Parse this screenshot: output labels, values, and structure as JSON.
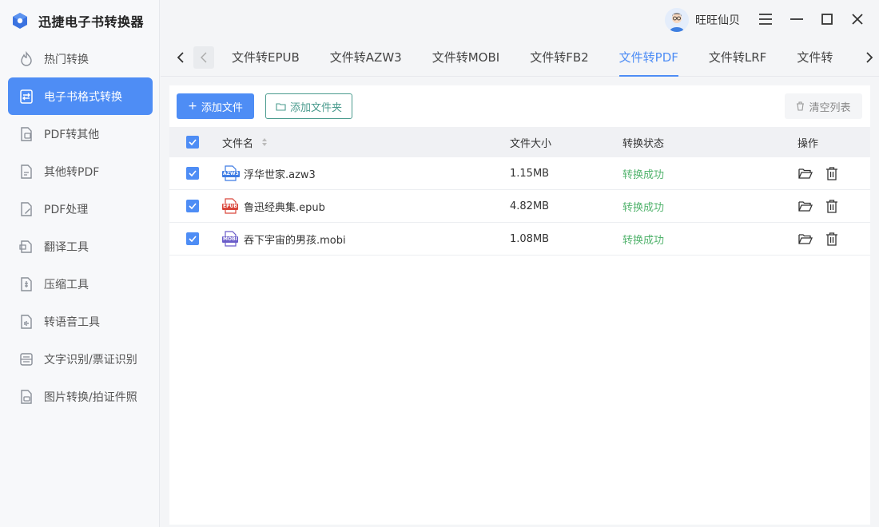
{
  "app": {
    "title": "迅捷电子书转换器"
  },
  "sidebar": {
    "items": [
      {
        "label": "热门转换",
        "icon": "flame-icon"
      },
      {
        "label": "电子书格式转换",
        "icon": "ebook-convert-icon"
      },
      {
        "label": "PDF转其他",
        "icon": "pdf-export-icon"
      },
      {
        "label": "其他转PDF",
        "icon": "pdf-import-icon"
      },
      {
        "label": "PDF处理",
        "icon": "pdf-edit-icon"
      },
      {
        "label": "翻译工具",
        "icon": "translate-icon"
      },
      {
        "label": "压缩工具",
        "icon": "compress-icon"
      },
      {
        "label": "转语音工具",
        "icon": "audio-icon"
      },
      {
        "label": "文字识别/票证识别",
        "icon": "ocr-icon"
      },
      {
        "label": "图片转换/拍证件照",
        "icon": "image-icon"
      }
    ]
  },
  "user": {
    "name": "旺旺仙贝"
  },
  "tabs": {
    "items": [
      "文件转EPUB",
      "文件转AZW3",
      "文件转MOBI",
      "文件转FB2",
      "文件转PDF",
      "文件转LRF",
      "文件转"
    ],
    "active_index": 4
  },
  "toolbar": {
    "add_file": "添加文件",
    "add_folder": "添加文件夹",
    "clear_list": "清空列表"
  },
  "table": {
    "headers": {
      "name": "文件名",
      "size": "文件大小",
      "status": "转换状态",
      "ops": "操作"
    },
    "rows": [
      {
        "name": "浮华世家.azw3",
        "type": "AZW3",
        "type_color": "#3d7be3",
        "size": "1.15MB",
        "status": "转换成功"
      },
      {
        "name": "鲁迅经典集.epub",
        "type": "EPUB",
        "type_color": "#d9463b",
        "size": "4.82MB",
        "status": "转换成功"
      },
      {
        "name": "吞下宇宙的男孩.mobi",
        "type": "MOBI",
        "type_color": "#6a5cc9",
        "size": "1.08MB",
        "status": "转换成功"
      }
    ]
  },
  "colors": {
    "accent": "#4e8df5",
    "success": "#52b36d",
    "outline": "#4a9b8e"
  }
}
